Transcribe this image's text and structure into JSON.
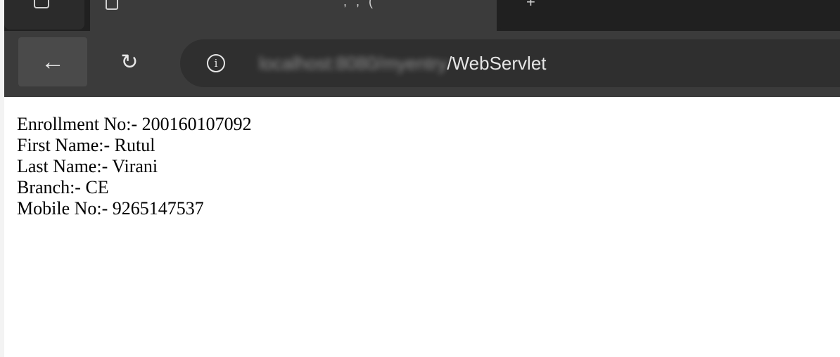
{
  "browser": {
    "tab_title_glyphs": ", , (",
    "new_tab_glyph": "+",
    "address": {
      "host_blurred": "localhost:8080/myentry",
      "path": "/WebServlet"
    },
    "icons": {
      "back": "←",
      "refresh": "↻",
      "info": "i"
    }
  },
  "page": {
    "lines": [
      {
        "label": "Enrollment No:- ",
        "value": "200160107092"
      },
      {
        "label": "First Name:- ",
        "value": "Rutul"
      },
      {
        "label": "Last Name:- ",
        "value": "Virani"
      },
      {
        "label": "Branch:- ",
        "value": "CE"
      },
      {
        "label": "Mobile No:- ",
        "value": "9265147537"
      }
    ]
  }
}
